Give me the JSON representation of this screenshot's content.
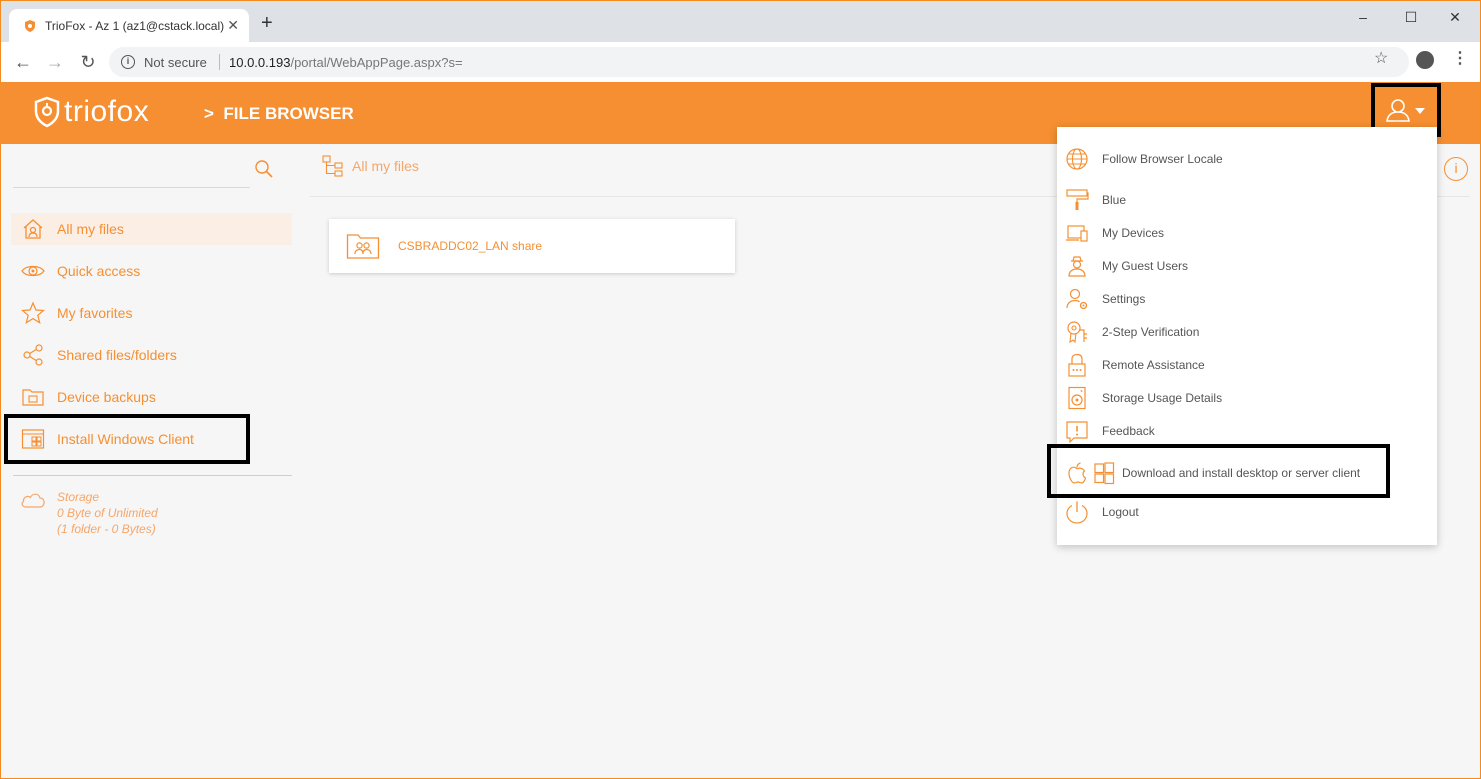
{
  "browser": {
    "tab_title": "TrioFox - Az 1 (az1@cstack.local)",
    "close_glyph": "✕",
    "new_tab_glyph": "+",
    "not_secure": "Not secure",
    "url_host": "10.0.0.193",
    "url_path": "/portal/WebAppPage.aspx?s="
  },
  "app": {
    "logo": "triofox",
    "breadcrumb_arrow": ">",
    "breadcrumb": "FILE BROWSER",
    "accent_color": "#f58f31"
  },
  "sidebar": {
    "items": [
      {
        "label": "All my files",
        "icon": "home-icon"
      },
      {
        "label": "Quick access",
        "icon": "eye-icon"
      },
      {
        "label": "My favorites",
        "icon": "star-icon"
      },
      {
        "label": "Shared files/folders",
        "icon": "share-icon"
      },
      {
        "label": "Device backups",
        "icon": "backup-folder-icon"
      },
      {
        "label": "Install Windows Client",
        "icon": "windows-client-icon"
      }
    ],
    "storage": {
      "title": "Storage",
      "usage": "0 Byte of Unlimited",
      "detail": "(1 folder - 0 Bytes)"
    }
  },
  "main": {
    "breadcrumb": "All my files",
    "folders": [
      {
        "name": "CSBRADDC02_LAN share",
        "icon": "shared-folder-icon"
      }
    ],
    "info_glyph": "i"
  },
  "user_menu": {
    "items": [
      {
        "label": "Follow Browser Locale",
        "icon": "globe-icon"
      },
      {
        "label": "Blue",
        "icon": "paint-roller-icon"
      },
      {
        "label": "My Devices",
        "icon": "devices-icon"
      },
      {
        "label": "My Guest Users",
        "icon": "guest-user-icon"
      },
      {
        "label": "Settings",
        "icon": "user-settings-icon"
      },
      {
        "label": "2-Step Verification",
        "icon": "key-badge-icon"
      },
      {
        "label": "Remote Assistance",
        "icon": "lock-icon"
      },
      {
        "label": "Storage Usage Details",
        "icon": "disk-icon"
      },
      {
        "label": "Feedback",
        "icon": "feedback-icon"
      },
      {
        "label": "Download and install desktop or server client",
        "icon": "apple-windows-icon"
      },
      {
        "label": "Logout",
        "icon": "power-icon"
      }
    ]
  }
}
